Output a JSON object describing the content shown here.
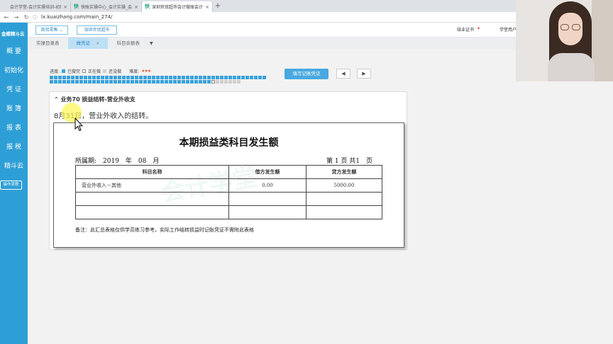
{
  "browser": {
    "tabs": [
      {
        "favicon": "",
        "label": "会计学堂-会计实操培训-初级中级...",
        "active": false
      },
      {
        "favicon": "快",
        "label": "快账实操中心_会计实操_会计培训",
        "active": false
      },
      {
        "favicon": "快",
        "label": "深圳世贸超市会计做账会计报表",
        "active": true
      }
    ],
    "url": "lx.kuaizhang.com/main_274/"
  },
  "sidebar": {
    "logo": "金蝶精斗云",
    "items": [
      "概 要",
      "初始化",
      "凭 证",
      "账 簿",
      "报 表",
      "报 税",
      "精斗云"
    ],
    "flow_button": "操作流程"
  },
  "header": {
    "industry_select": "商贸零售",
    "company": "深圳世贸超市",
    "cert": "结业证书",
    "user": "学堂用户"
  },
  "page_tabs": [
    {
      "label": "实操目录表",
      "active": false
    },
    {
      "label": "做凭证",
      "active": true
    },
    {
      "label": "科目余额表",
      "active": false
    }
  ],
  "progress": {
    "label": "进度:",
    "done_label": "已做完",
    "doing_label": "正在做",
    "none_label": "还没做",
    "difficulty_label": "难度:",
    "difficulty_stars": "★★★",
    "done_count": 89,
    "doing_index": 90,
    "total": 96
  },
  "fill_voucher_button": "填写记账凭证",
  "prev_icon": "◀",
  "next_icon": "▶",
  "task": {
    "title": "业务70 损益结转-营业外收支",
    "desc": "8月31日，营业外收入的结转。"
  },
  "report": {
    "title": "本期损益类科目发生额",
    "period": "所属期:　2019　年　08　月",
    "page": "第 1 页 共1　页",
    "headers": [
      "科目名称",
      "借方发生额",
      "贷方发生额"
    ],
    "rows": [
      [
        "营业外收入－其他",
        "0.00",
        "5000.00"
      ],
      [
        "",
        "",
        ""
      ],
      [
        "",
        "",
        ""
      ]
    ],
    "note": "备注：此汇总表格仅供学员练习参考，实际工作结转损益时记账凭证不需附此表格",
    "watermark": "会计学堂"
  },
  "colors": {
    "sidebar": "#2e9fd6",
    "accent": "#49a8e0",
    "progress_done": "#3ba2dc",
    "highlight": "#fff550"
  }
}
